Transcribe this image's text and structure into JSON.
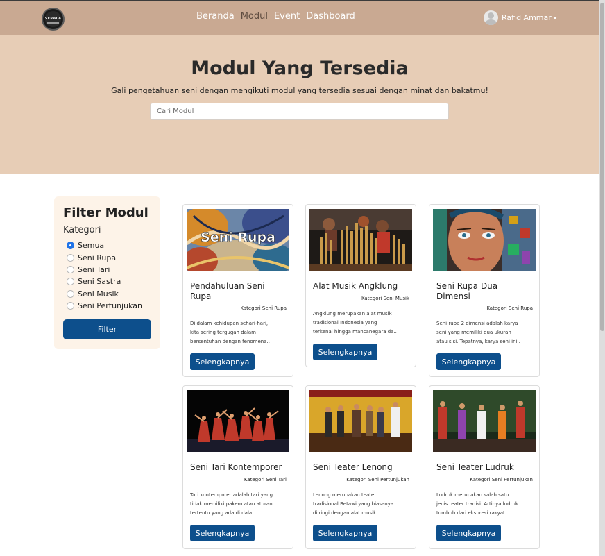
{
  "navbar": {
    "logo_text": "SERALA",
    "links": [
      "Beranda",
      "Modul",
      "Event",
      "Dashboard"
    ],
    "active_link": "Modul",
    "user_name": "Rafid Ammar"
  },
  "hero": {
    "title": "Modul Yang Tersedia",
    "subtitle": "Gali pengetahuan seni dengan mengikuti modul yang tersedia sesuai dengan minat dan bakatmu!",
    "search_placeholder": "Cari Modul"
  },
  "filter": {
    "title": "Filter Modul",
    "group_label": "Kategori",
    "options": [
      "Semua",
      "Seni Rupa",
      "Seni Tari",
      "Seni Sastra",
      "Seni Musik",
      "Seni Pertunjukan"
    ],
    "selected": "Semua",
    "button_label": "Filter"
  },
  "cards": [
    {
      "title": "Pendahuluan Seni Rupa",
      "category": "Kategori Seni Rupa",
      "description": "Di dalam kehidupan sehari-hari, kita sering tergugah dalam bersentuhan dengan fenomena..",
      "button": "Selengkapnya",
      "image_text": "Seni Rupa"
    },
    {
      "title": "Alat Musik Angklung",
      "category": "Kategori Seni Musik",
      "description": "Angklung merupakan alat musik tradisional Indonesia yang terkenal hingga mancanegara da..",
      "button": "Selengkapnya"
    },
    {
      "title": "Seni Rupa Dua Dimensi",
      "category": "Kategori Seni Rupa",
      "description": "Seni rupa 2 dimensi adalah karya seni yang memiliki dua ukuran atau sisi. Tepatnya, karya seni ini..",
      "button": "Selengkapnya"
    },
    {
      "title": "Seni Tari Kontemporer",
      "category": "Kategori Seni Tari",
      "description": "Tari kontemporer adalah tari yang tidak memiliki pakem atau aturan tertentu yang ada di dala..",
      "button": "Selengkapnya"
    },
    {
      "title": "Seni Teater Lenong",
      "category": "Kategori Seni Pertunjukan",
      "description": "Lenong merupakan teater tradisional Betawi yang biasanya diiringi dengan alat musik..",
      "button": "Selengkapnya"
    },
    {
      "title": "Seni Teater Ludruk",
      "category": "Kategori Seni Pertunjukan",
      "description": "Ludruk merupakan salah satu jenis teater tradisi. Artinya ludruk tumbuh dari ekspresi rakyat..",
      "button": "Selengkapnya"
    }
  ]
}
